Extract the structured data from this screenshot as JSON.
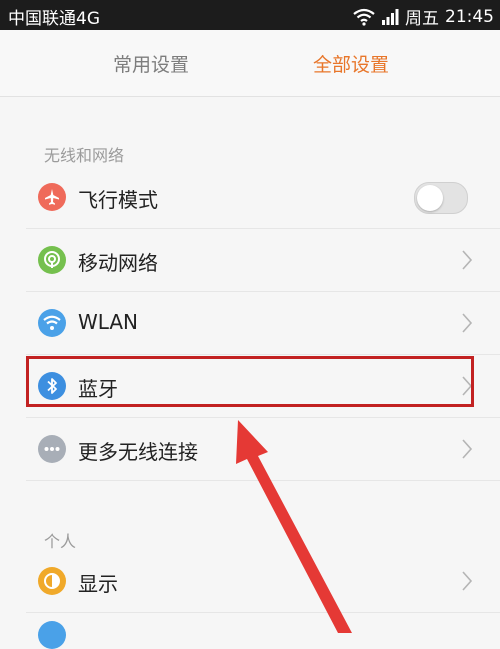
{
  "status_bar": {
    "carrier": "中国联通4G",
    "day": "周五",
    "time": "21:45"
  },
  "tabs": [
    {
      "label": "常用设置",
      "active": false
    },
    {
      "label": "全部设置",
      "active": true
    }
  ],
  "sections": [
    {
      "title": "无线和网络",
      "items": [
        {
          "label": "飞行模式",
          "icon": "airplane-icon",
          "icon_color": "#ef6a5a",
          "control": "toggle",
          "toggle_on": false
        },
        {
          "label": "移动网络",
          "icon": "mobile-network-icon",
          "icon_color": "#75c04e",
          "control": "chevron"
        },
        {
          "label": "WLAN",
          "icon": "wifi-icon",
          "icon_color": "#4aa1e8",
          "control": "chevron"
        },
        {
          "label": "蓝牙",
          "icon": "bluetooth-icon",
          "icon_color": "#3d8fe0",
          "control": "chevron",
          "highlighted": true
        },
        {
          "label": "更多无线连接",
          "icon": "more-icon",
          "icon_color": "#a8aeb7",
          "control": "chevron"
        }
      ]
    },
    {
      "title": "个人",
      "items": [
        {
          "label": "显示",
          "icon": "display-icon",
          "icon_color": "#f0a92a",
          "control": "chevron"
        }
      ]
    }
  ],
  "annotation": {
    "highlight_color": "#c22222",
    "arrow_color": "#e53935"
  }
}
